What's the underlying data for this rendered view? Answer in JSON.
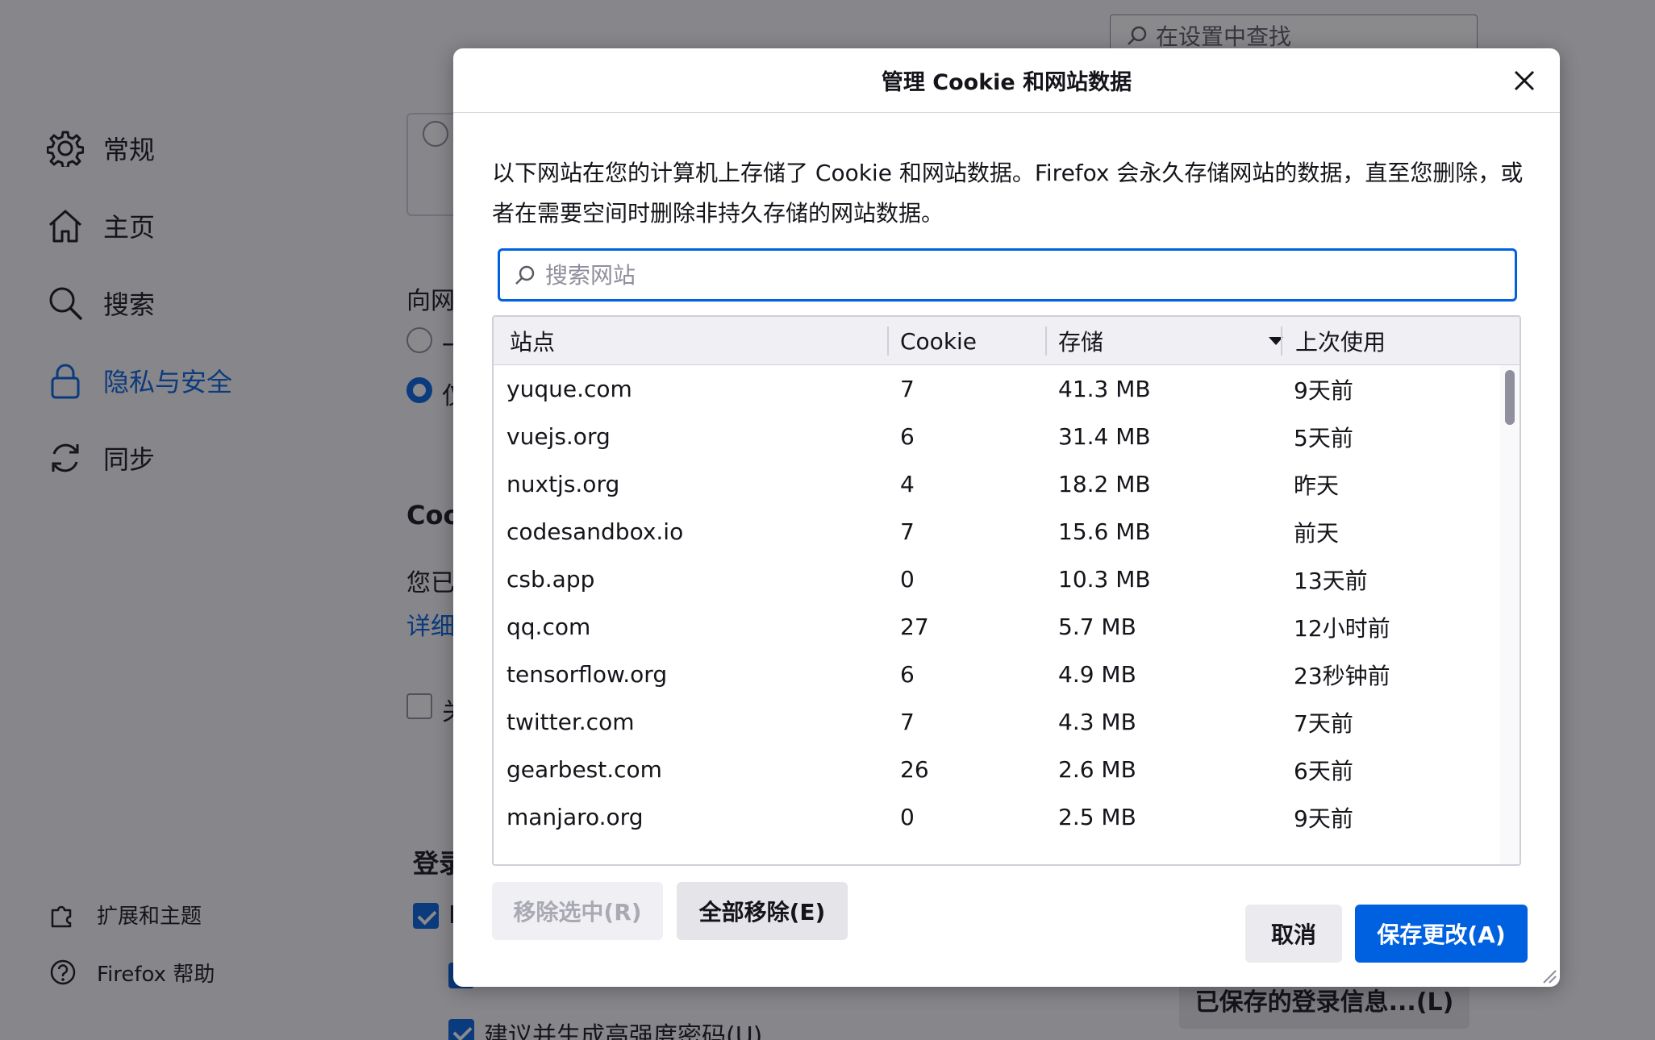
{
  "background": {
    "search_placeholder": "在设置中查找",
    "nav": [
      {
        "label": "常规",
        "icon": "gear-icon"
      },
      {
        "label": "主页",
        "icon": "home-icon"
      },
      {
        "label": "搜索",
        "icon": "search-icon"
      },
      {
        "label": "隐私与安全",
        "icon": "lock-icon"
      },
      {
        "label": "同步",
        "icon": "sync-icon"
      }
    ],
    "nav_bottom": [
      {
        "label": "扩展和主题",
        "icon": "puzzle-icon"
      },
      {
        "label": "Firefox 帮助",
        "icon": "help-icon"
      }
    ],
    "fragments": {
      "f1": "向网",
      "f2": "一",
      "f3": "仅",
      "f4": "Coo",
      "f5": "您已",
      "f6": "详细",
      "f7": "关",
      "f8": "登录",
      "f9": "I",
      "f10": "建议并生成高强度密码(U)"
    },
    "saved_logins_button": "已保存的登录信息...(L)"
  },
  "dialog": {
    "title": "管理 Cookie 和网站数据",
    "description": "以下网站在您的计算机上存储了 Cookie 和网站数据。Firefox 会永久存储网站的数据，直至您删除，或者在需要空间时删除非持久存储的网站数据。",
    "search_placeholder": "搜索网站",
    "columns": {
      "site": "站点",
      "cookie": "Cookie",
      "storage": "存储",
      "last_used": "上次使用"
    },
    "rows": [
      {
        "site": "yuque.com",
        "cookie": "7",
        "storage": "41.3 MB",
        "last_used": "9天前"
      },
      {
        "site": "vuejs.org",
        "cookie": "6",
        "storage": "31.4 MB",
        "last_used": "5天前"
      },
      {
        "site": "nuxtjs.org",
        "cookie": "4",
        "storage": "18.2 MB",
        "last_used": "昨天"
      },
      {
        "site": "codesandbox.io",
        "cookie": "7",
        "storage": "15.6 MB",
        "last_used": "前天"
      },
      {
        "site": "csb.app",
        "cookie": "0",
        "storage": "10.3 MB",
        "last_used": "13天前"
      },
      {
        "site": "qq.com",
        "cookie": "27",
        "storage": "5.7 MB",
        "last_used": "12小时前"
      },
      {
        "site": "tensorflow.org",
        "cookie": "6",
        "storage": "4.9 MB",
        "last_used": "23秒钟前"
      },
      {
        "site": "twitter.com",
        "cookie": "7",
        "storage": "4.3 MB",
        "last_used": "7天前"
      },
      {
        "site": "gearbest.com",
        "cookie": "26",
        "storage": "2.6 MB",
        "last_used": "6天前"
      },
      {
        "site": "manjaro.org",
        "cookie": "0",
        "storage": "2.5 MB",
        "last_used": "9天前"
      }
    ],
    "buttons": {
      "remove_selected": "移除选中(R)",
      "remove_all": "全部移除(E)",
      "cancel": "取消",
      "save": "保存更改(A)"
    },
    "colors": {
      "accent": "#0061e0"
    }
  }
}
